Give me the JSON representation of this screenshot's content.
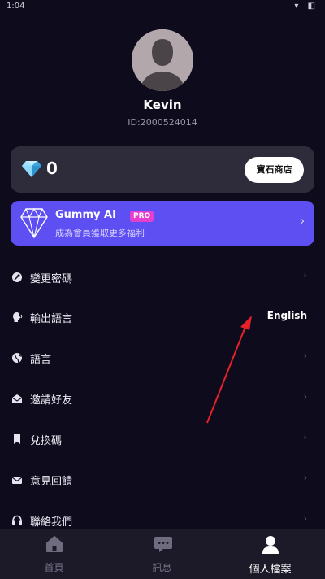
{
  "status_bar": {
    "time": "1:04",
    "icons": "▾ ◧"
  },
  "profile": {
    "name": "Kevin",
    "id_label": "ID:2000524014"
  },
  "gems": {
    "count": "0",
    "shop_label": "寶石商店"
  },
  "pro": {
    "title": "Gummy AI",
    "badge": "PRO",
    "subtitle": "成為會員獲取更多福利",
    "chevron": "›"
  },
  "menu": {
    "items": [
      {
        "label": "變更密碼",
        "icon": "key-icon",
        "chevron": "›"
      },
      {
        "label": "輸出語言",
        "icon": "speaking-head-icon",
        "value": "English"
      },
      {
        "label": "語言",
        "icon": "globe-icon",
        "chevron": "›"
      },
      {
        "label": "邀請好友",
        "icon": "envelope-open-icon",
        "chevron": "›"
      },
      {
        "label": "兌換碼",
        "icon": "bookmark-icon",
        "chevron": "›"
      },
      {
        "label": "意見回饋",
        "icon": "envelope-icon",
        "chevron": "›"
      },
      {
        "label": "聯絡我們",
        "icon": "headset-icon",
        "chevron": "›"
      }
    ]
  },
  "tabs": [
    {
      "label": "首頁",
      "icon": "home-icon",
      "active": false
    },
    {
      "label": "訊息",
      "icon": "chat-bubble-icon",
      "active": false
    },
    {
      "label": "個人檔案",
      "icon": "person-icon",
      "active": true
    }
  ],
  "colors": {
    "background": "#0e0c1c",
    "card": "#2e2c3a",
    "pro_card": "#5d4ff2",
    "pro_badge": "#e63ecf",
    "annotation_arrow": "#e8202a",
    "tab_bar": "#1c1a29"
  }
}
